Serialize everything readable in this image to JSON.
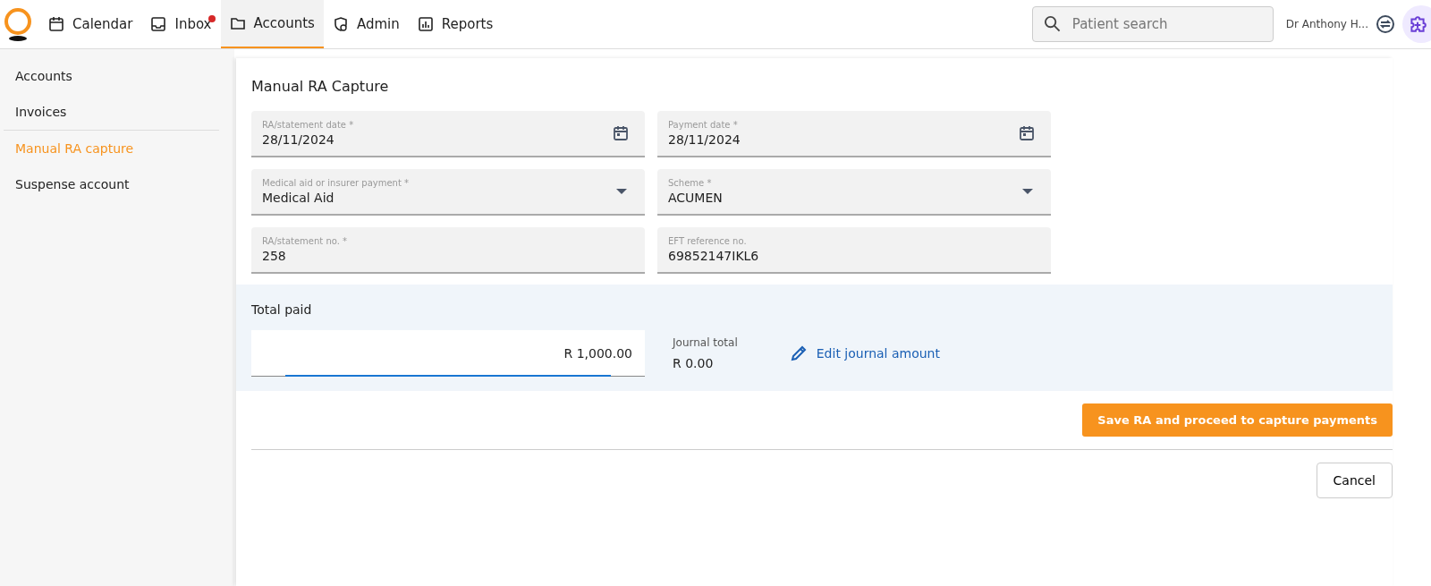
{
  "nav": {
    "items": [
      {
        "label": "Calendar",
        "kind": "calendar",
        "selected": false,
        "badge": false
      },
      {
        "label": "Inbox",
        "kind": "inbox",
        "selected": false,
        "badge": true
      },
      {
        "label": "Accounts",
        "kind": "folder",
        "selected": true,
        "badge": false
      },
      {
        "label": "Admin",
        "kind": "admin",
        "selected": false,
        "badge": false
      },
      {
        "label": "Reports",
        "kind": "reports",
        "selected": false,
        "badge": false
      }
    ],
    "search": {
      "placeholder": "Patient search"
    },
    "user": "Dr Anthony H..."
  },
  "sidebar": {
    "items": [
      {
        "label": "Accounts",
        "selected": false,
        "divider_after": false
      },
      {
        "label": "Invoices",
        "selected": false,
        "divider_after": true
      },
      {
        "label": "Manual RA capture",
        "selected": true,
        "divider_after": false
      },
      {
        "label": "Suspense account",
        "selected": false,
        "divider_after": false
      }
    ]
  },
  "form": {
    "title": "Manual RA Capture",
    "fields": [
      {
        "label": "RA/statement date *",
        "value": "28/11/2024",
        "kind": "date"
      },
      {
        "label": "Payment date *",
        "value": "28/11/2024",
        "kind": "date"
      },
      {
        "label": "Medical aid or insurer payment *",
        "value": "Medical Aid",
        "kind": "select"
      },
      {
        "label": "Scheme *",
        "value": "ACUMEN",
        "kind": "select"
      },
      {
        "label": "RA/statement no. *",
        "value": "258",
        "kind": "text"
      },
      {
        "label": "EFT reference no.",
        "value": "69852147IKL6",
        "kind": "text"
      }
    ],
    "total": {
      "label": "Total paid",
      "value": "R 1,000.00",
      "journal_label": "Journal total",
      "journal_value": "R 0.00",
      "edit": "Edit journal amount"
    },
    "save": "Save RA and proceed to capture payments",
    "cancel": "Cancel"
  }
}
